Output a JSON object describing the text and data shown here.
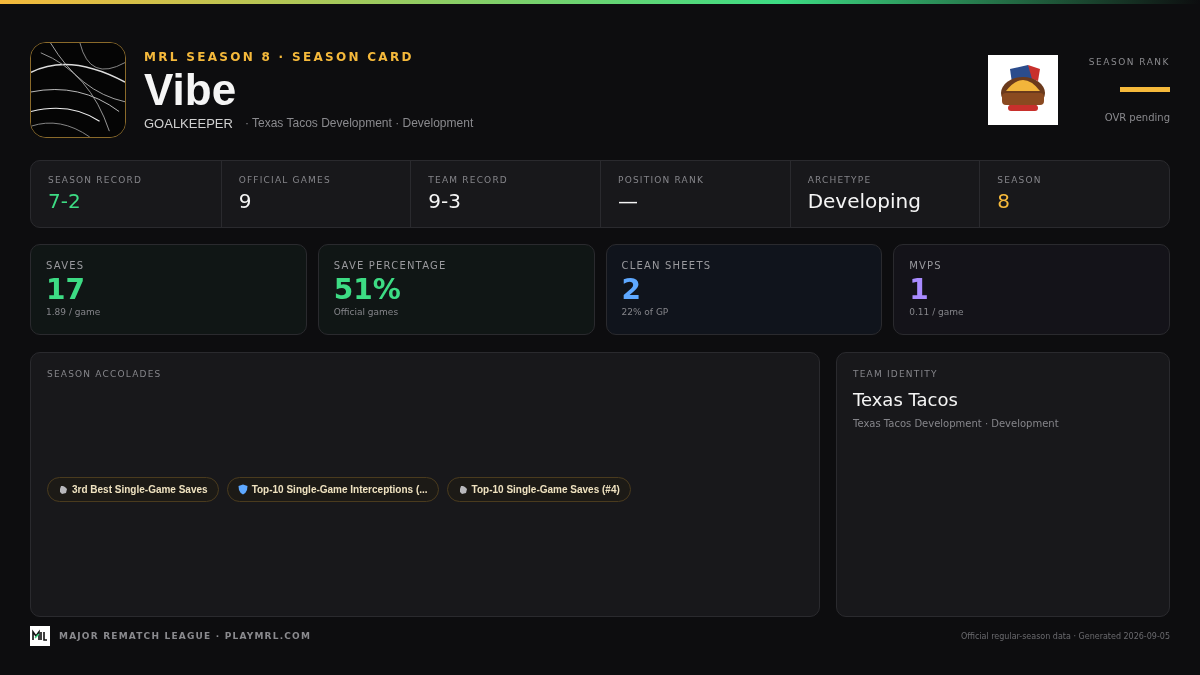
{
  "header": {
    "eyebrow": "MRL SEASON 8 · SEASON CARD",
    "player_name": "Vibe",
    "position": "GOALKEEPER",
    "team_line": "· Texas Tacos Development · Development",
    "rank": {
      "label": "SEASON RANK",
      "note": "OVR pending"
    }
  },
  "summary": [
    {
      "label": "SEASON RECORD",
      "value": "7-2",
      "color": "#3ddc84"
    },
    {
      "label": "OFFICIAL GAMES",
      "value": "9",
      "color": "#f5f5f5"
    },
    {
      "label": "TEAM RECORD",
      "value": "9-3",
      "color": "#f5f5f5"
    },
    {
      "label": "POSITION RANK",
      "value": "—",
      "color": "#f5f5f5"
    },
    {
      "label": "ARCHETYPE",
      "value": "Developing",
      "color": "#f5f5f5"
    },
    {
      "label": "SEASON",
      "value": "8",
      "color": "#f5b93b"
    }
  ],
  "stat_cards": [
    {
      "label": "SAVES",
      "value": "17",
      "sub": "1.89 / game",
      "color": "#3ddc84"
    },
    {
      "label": "SAVE PERCENTAGE",
      "value": "51%",
      "sub": "Official games",
      "color": "#3ddc84"
    },
    {
      "label": "CLEAN SHEETS",
      "value": "2",
      "sub": "22% of GP",
      "color": "#5ea8ff"
    },
    {
      "label": "MVPS",
      "value": "1",
      "sub": "0.11 / game",
      "color": "#a98bff"
    }
  ],
  "accolades": {
    "title": "SEASON ACCOLADES",
    "items": [
      {
        "kind": "glove",
        "label": "3rd Best Single-Game Saves"
      },
      {
        "kind": "shield",
        "label": "Top-10 Single-Game Interceptions (..."
      },
      {
        "kind": "glove",
        "label": "Top-10 Single-Game Saves (#4)"
      }
    ]
  },
  "team_identity": {
    "title": "TEAM IDENTITY",
    "name": "Texas Tacos",
    "sub": "Texas Tacos Development · Development"
  },
  "footer": {
    "brand": "MAJOR REMATCH LEAGUE · PLAYMRL.COM",
    "note": "Official regular-season data · Generated 2026-09-05"
  }
}
